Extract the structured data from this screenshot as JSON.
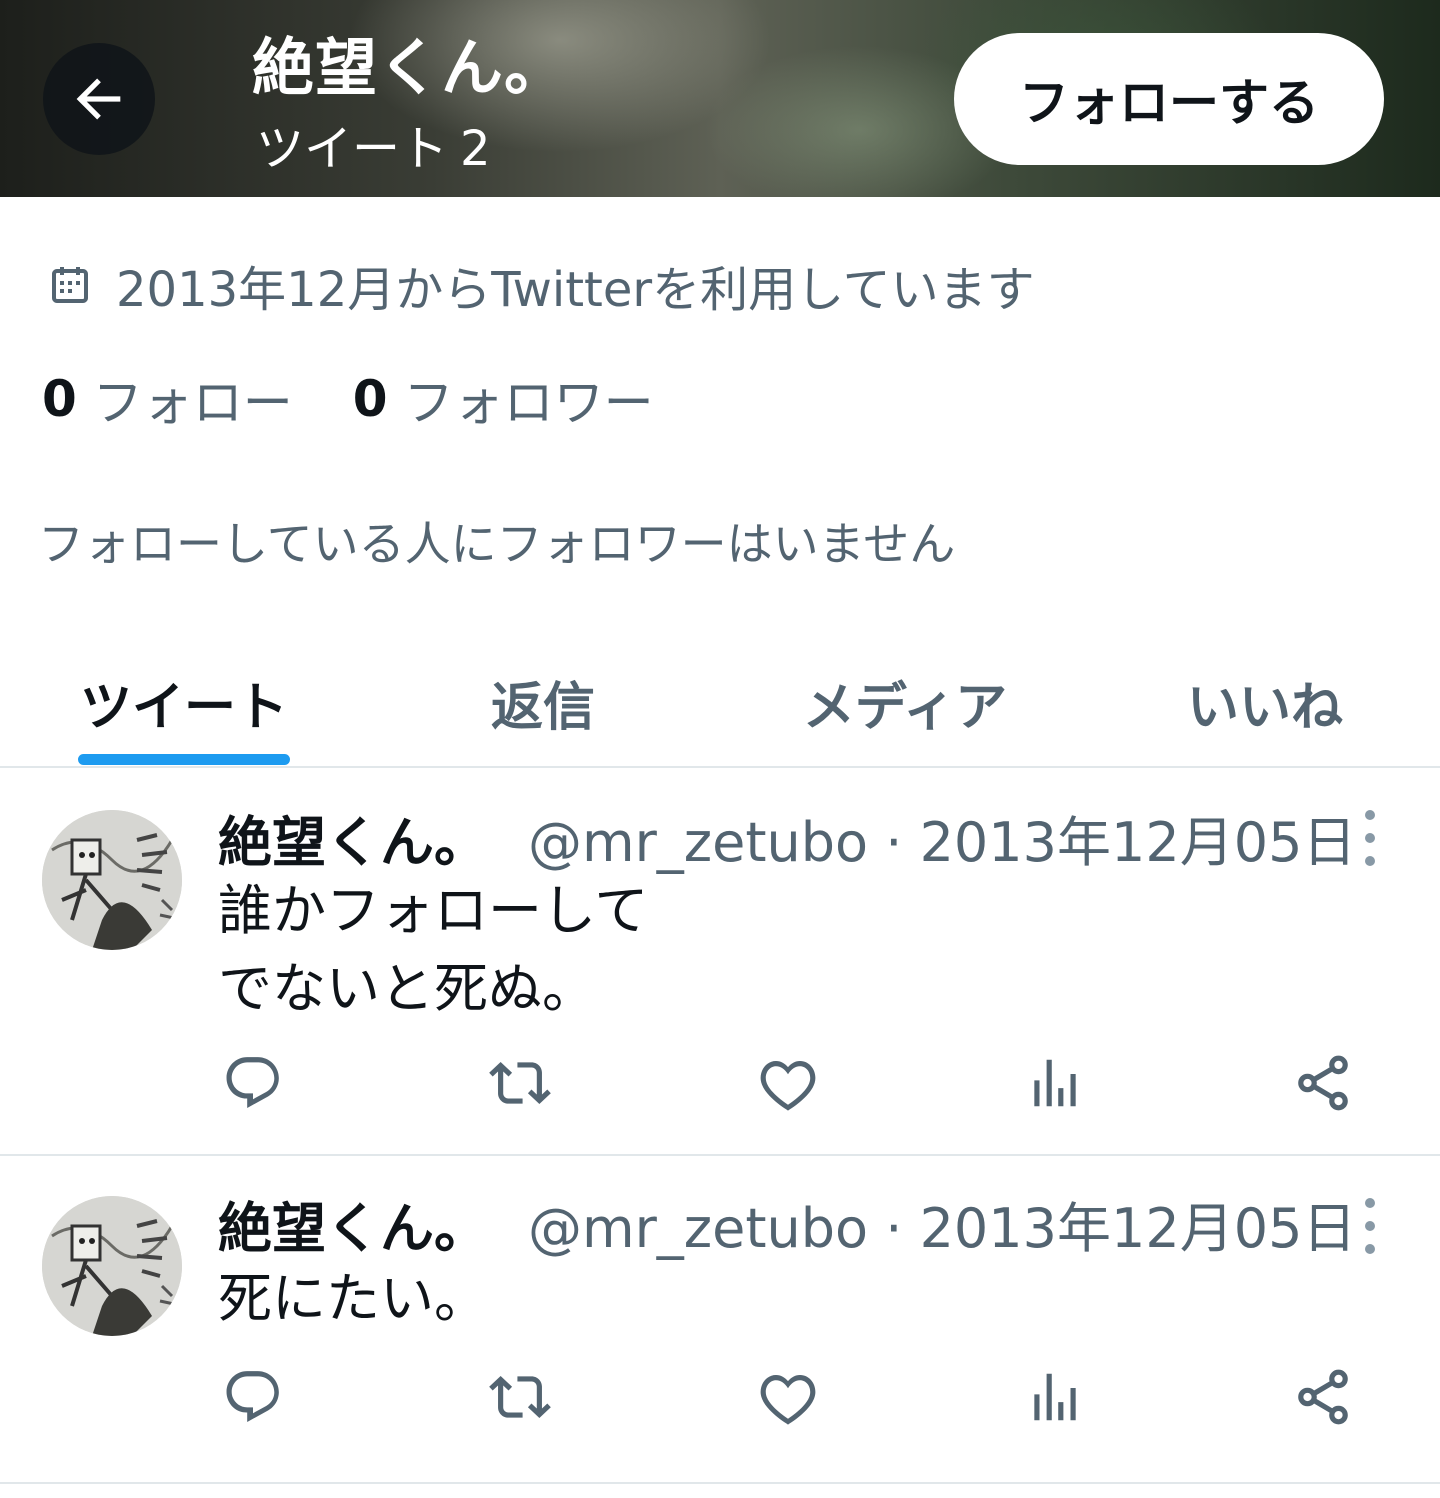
{
  "header": {
    "title": "絶望くん。",
    "tweets_label": "ツイート",
    "tweets_count": "2",
    "follow_button": "フォローする"
  },
  "profile": {
    "joined": "2013年12月からTwitterを利用しています",
    "following_count": "0",
    "following_label": "フォロー",
    "followers_count": "0",
    "followers_label": "フォロワー",
    "mutual_note": "フォローしている人にフォロワーはいません"
  },
  "tabs": [
    {
      "label": "ツイート",
      "active": true
    },
    {
      "label": "返信",
      "active": false
    },
    {
      "label": "メディア",
      "active": false
    },
    {
      "label": "いいね",
      "active": false
    }
  ],
  "tweets": [
    {
      "name": "絶望くん。",
      "meta": "@mr_zetubo · 2013年12月05日",
      "lines": [
        "誰かフォローして",
        "でないと死ぬ。"
      ]
    },
    {
      "name": "絶望くん。",
      "meta": "@mr_zetubo · 2013年12月05日",
      "lines": [
        "死にたい。"
      ]
    }
  ],
  "colors": {
    "accent": "#1d9bf0",
    "text_primary": "#0f1419",
    "text_secondary": "#536471",
    "divider": "#e1e7ea"
  },
  "icons": {
    "back": "arrow-left-icon",
    "joined": "calendar-icon",
    "reply": "reply-icon",
    "retweet": "retweet-icon",
    "like": "heart-icon",
    "views": "analytics-icon",
    "share": "share-icon",
    "more": "more-vertical-icon"
  }
}
